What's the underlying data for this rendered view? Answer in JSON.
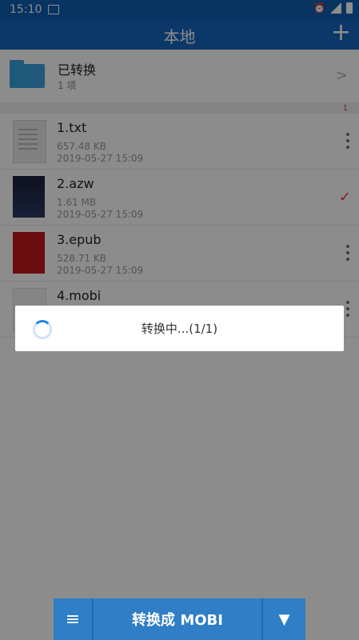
{
  "statusbar": {
    "time": "15:10"
  },
  "appbar": {
    "title": "本地",
    "add_icon": "+"
  },
  "folder": {
    "title": "已转换",
    "count": "1 项"
  },
  "badge": "1",
  "files": [
    {
      "name": "1.txt",
      "size": "657.48 KB",
      "date": "2019-05-27 15:09"
    },
    {
      "name": "2.azw",
      "size": "1.61 MB",
      "date": "2019-05-27 15:09"
    },
    {
      "name": "3.epub",
      "size": "528.71 KB",
      "date": "2019-05-27 15:09"
    },
    {
      "name": "4.mobi",
      "size": "",
      "date": ""
    }
  ],
  "dialog": {
    "message": "转换中...(1/1)"
  },
  "bottom": {
    "menu_icon": "≡",
    "convert_label": "转换成 MOBI",
    "dropdown_icon": "▼"
  },
  "colors": {
    "primary": "#1565c0",
    "check": "#e53935"
  }
}
